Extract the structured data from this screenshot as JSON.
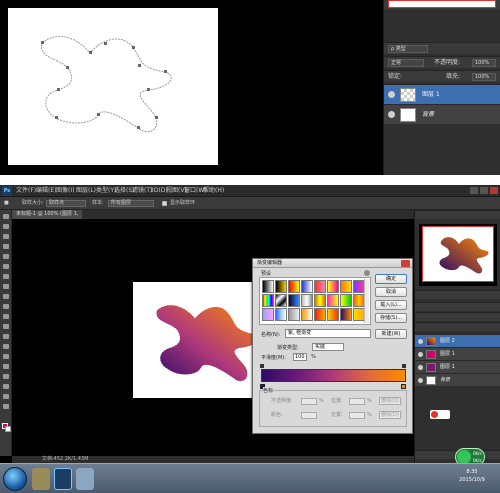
{
  "top": {
    "mode_label": "正常",
    "opacity_label": "不透明度:",
    "opacity_value": "100%",
    "lock_label": "锁定:",
    "fill_label": "填充:",
    "fill_value": "100%",
    "kind_label": "ρ 类型",
    "layers": [
      {
        "name": "图层 1",
        "active": true
      },
      {
        "name": "背景",
        "active": false
      }
    ]
  },
  "bottom": {
    "app_logo": "Ps",
    "menu": [
      "文件(F)",
      "编辑(E)",
      "图像(I)",
      "图层(L)",
      "类型(Y)",
      "选择(S)",
      "滤镜(T)",
      "3D(D)",
      "视图(V)",
      "窗口(W)",
      "帮助(H)"
    ],
    "options": {
      "swatch_label": "■",
      "size_label": "取样大小:",
      "size_value": "取样点",
      "sample_label": "样本:",
      "sample_value": "所有图层",
      "ring_label": "显示取样环"
    },
    "doc_tab": "未标题-1 @ 100% (图层 1, RGB/8)",
    "status": "文档:452.2K/1.43M",
    "right_layers": [
      {
        "name": "图层 2",
        "active": true
      },
      {
        "name": "图层 1",
        "active": false
      },
      {
        "name": "图层 1",
        "active": false
      },
      {
        "name": "背景",
        "active": false
      }
    ],
    "clock": {
      "time": "8:35",
      "date": "2015/10/9"
    },
    "net": {
      "up": "0K/s",
      "down": "0K/s"
    }
  },
  "dialog": {
    "title": "渐变编辑器",
    "presets_label": "预设",
    "buttons": {
      "ok": "确定",
      "cancel": "取消",
      "load": "载入(L)...",
      "save": "存储(S)...",
      "new": "新建(W)"
    },
    "name_label": "名称(N):",
    "name_value": "紫, 橙渐变",
    "type_label": "渐变类型:",
    "type_value": "实底",
    "smooth_label": "平滑度(M):",
    "smooth_value": "100",
    "smooth_unit": "%",
    "stops_label": "色标",
    "opacity_label": "不透明度:",
    "location_label": "位置:",
    "delete_label": "删除(D)",
    "color_label": "颜色:",
    "percent": "%",
    "colors": {
      "start": "#2e0a6a",
      "end": "#ff8a00"
    }
  }
}
